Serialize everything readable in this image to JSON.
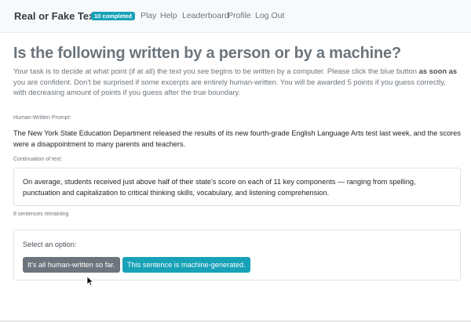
{
  "navbar": {
    "brand": "Real or Fake Text?",
    "badge": "10 completed",
    "links": [
      "Play",
      "Help",
      "Leaderboard",
      "Profile",
      "Log Out"
    ]
  },
  "main": {
    "title": "Is the following written by a person or by a machine?",
    "intro_part1": "Your task is to decide at what point (if at all) the text you see begins to be written by a computer. Please click the blue button ",
    "intro_bold": "as soon as",
    "intro_part2": " you are confident. Don't be surprised if some excerpts are entirely human-written. You will be awarded 5 points if you guess correctly, with decreasing amount of points if you guess after the true boundary.",
    "prompt_label": "Human-Written Prompt:",
    "prompt_text": "The New York State Education Department released the results of its new fourth-grade English Language Arts test last week, and the scores were a disappointment to many parents and teachers.",
    "continuation_label": "Continuation of text:",
    "continuation_text": "On average, students received just above half of their state's score on each of 11 key components — ranging from spelling, punctuation and capitalization to critical thinking skills, vocabulary, and listening comprehension.",
    "sentences_remaining": "8 sentences remaining",
    "select_label": "Select an option:",
    "human_button": "It's all human-written so far.",
    "machine_button": "This sentence is machine-generated."
  },
  "colors": {
    "accent": "#17a2b8",
    "secondary": "#6c757d"
  }
}
